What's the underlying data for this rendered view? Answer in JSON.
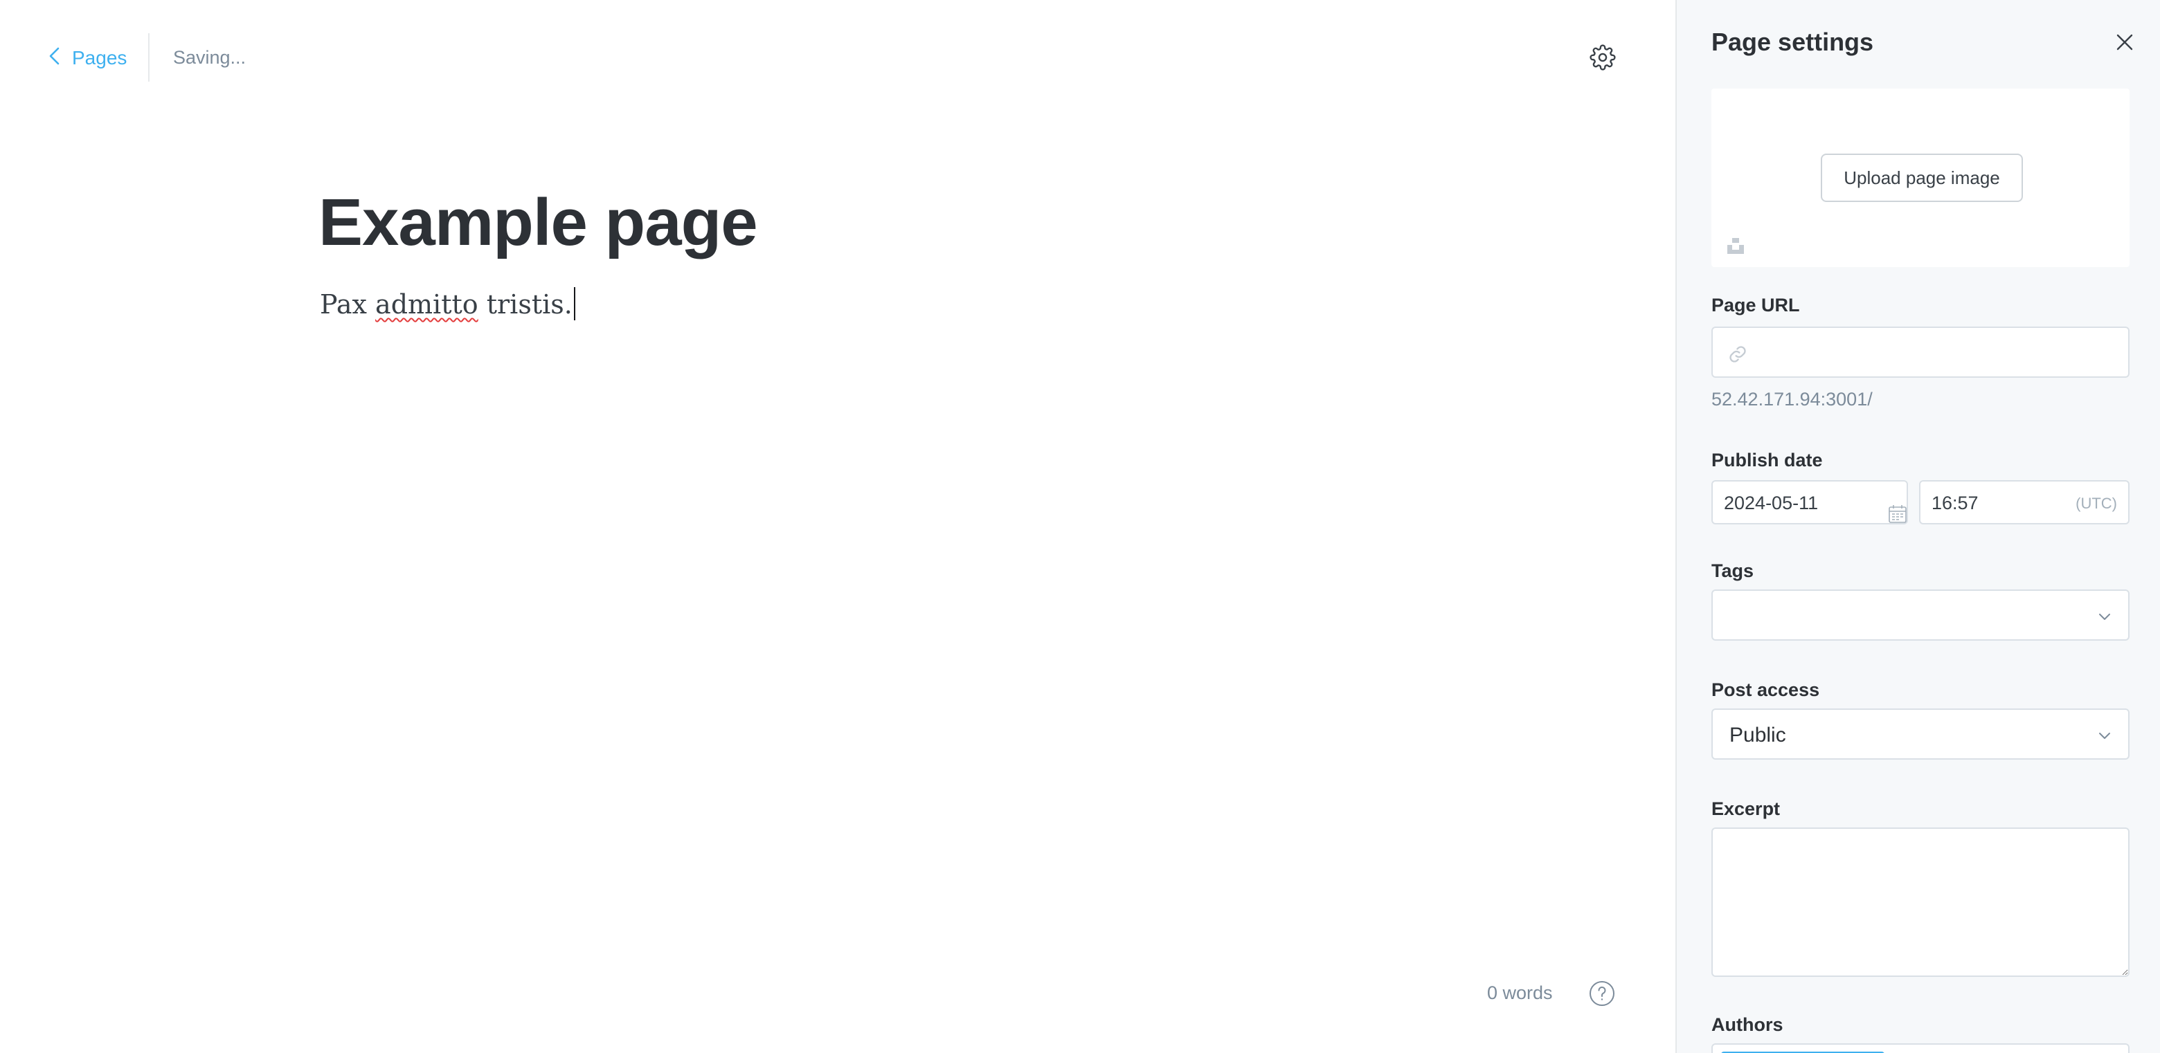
{
  "editor": {
    "back_label": "Pages",
    "status": "Saving...",
    "title": "Example page",
    "body": {
      "word1": "Pax",
      "word2": "admitto",
      "word3": "tristis."
    },
    "word_count": "0 words"
  },
  "icons": {
    "back": "chevron-left-icon",
    "settings": "gear-icon",
    "help": "question-circle-icon",
    "close": "close-icon",
    "unsplash": "unsplash-icon",
    "link": "link-icon",
    "calendar": "calendar-icon",
    "dropdown": "chevron-down-icon"
  },
  "colors": {
    "accent": "#3eb0ef",
    "panel_bg": "#f6f8fa",
    "muted_text": "#7c8b9a"
  },
  "settings_panel": {
    "title": "Page settings",
    "upload_label": "Upload page image",
    "url": {
      "label": "Page URL",
      "value": "",
      "hint": "52.42.171.94:3001/"
    },
    "publish_date": {
      "label": "Publish date",
      "date": "2024-05-11",
      "time": "16:57",
      "timezone": "(UTC)"
    },
    "tags": {
      "label": "Tags",
      "value": ""
    },
    "post_access": {
      "label": "Post access",
      "value": "Public"
    },
    "excerpt": {
      "label": "Excerpt",
      "value": ""
    },
    "authors": {
      "label": "Authors"
    }
  }
}
